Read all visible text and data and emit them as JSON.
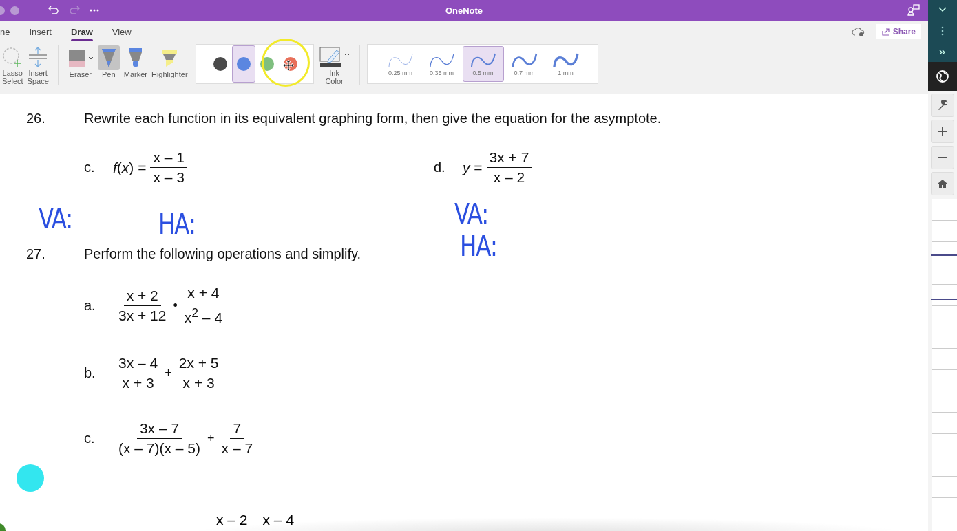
{
  "window": {
    "title": "OneNote"
  },
  "ribbon_tabs": [
    {
      "label": "ne",
      "selected": false
    },
    {
      "label": "Insert",
      "selected": false
    },
    {
      "label": "Draw",
      "selected": true
    },
    {
      "label": "View",
      "selected": false
    }
  ],
  "share_button": "Share",
  "tools": [
    {
      "label": "Lasso Select",
      "kind": "lasso",
      "selected": false
    },
    {
      "label": "Insert Space",
      "kind": "space",
      "selected": false
    },
    {
      "label": "Eraser",
      "kind": "eraser",
      "selected": false
    },
    {
      "label": "Pen",
      "kind": "pen",
      "selected": true
    },
    {
      "label": "Marker",
      "kind": "marker",
      "selected": false
    },
    {
      "label": "Highlighter",
      "kind": "highlighter",
      "selected": false
    }
  ],
  "ink_colors": [
    {
      "color": "#4a4a4a",
      "selected": false
    },
    {
      "color": "#5b86e0",
      "selected": true
    },
    {
      "color": "#7fbf7f",
      "selected": false
    },
    {
      "color": "#e8705a",
      "selected": false
    }
  ],
  "ink_color_button": "Ink Color",
  "pen_widths": [
    {
      "label": "0.25 mm",
      "selected": false
    },
    {
      "label": "0.35 mm",
      "selected": false
    },
    {
      "label": "0.5 mm",
      "selected": true
    },
    {
      "label": "0.7 mm",
      "selected": false
    },
    {
      "label": "1 mm",
      "selected": false
    }
  ],
  "problems": [
    {
      "number": "26.",
      "text": "Rewrite each function in its equivalent graphing form, then give the equation for the asymptote.",
      "parts": [
        {
          "label": "c.",
          "terms": [
            {
              "kind": "text",
              "text": "*f*(*x*) ="
            },
            {
              "kind": "frac",
              "num": "x – 1",
              "den": "x – 3"
            }
          ]
        },
        {
          "label": "d.",
          "terms": [
            {
              "kind": "text",
              "text": "*y* ="
            },
            {
              "kind": "frac",
              "num": "3x + 7",
              "den": "x – 2"
            }
          ]
        }
      ]
    },
    {
      "number": "27.",
      "text": "Perform the following operations and simplify.",
      "parts": [
        {
          "label": "a.",
          "terms": [
            {
              "kind": "frac",
              "num": "x + 2",
              "den": "3x + 12"
            },
            {
              "kind": "op",
              "text": "•"
            },
            {
              "kind": "frac",
              "num": "x + 4",
              "den": "x$^{2}$ – 4"
            }
          ]
        },
        {
          "label": "b.",
          "terms": [
            {
              "kind": "frac",
              "num": "3x – 4",
              "den": "x + 3"
            },
            {
              "kind": "op",
              "text": "+"
            },
            {
              "kind": "frac",
              "num": "2x + 5",
              "den": "x + 3"
            }
          ]
        },
        {
          "label": "c.",
          "terms": [
            {
              "kind": "frac",
              "num": "3x – 7",
              "den": "(x – 7)(x – 5)"
            },
            {
              "kind": "op",
              "text": "+"
            },
            {
              "kind": "frac",
              "num": "7",
              "den": "x – 7"
            }
          ]
        }
      ]
    }
  ],
  "partial_numerators": [
    "x – 2",
    "x – 4"
  ],
  "ink_notes": [
    "VA:",
    "HA:",
    "VA:",
    "HA:"
  ]
}
